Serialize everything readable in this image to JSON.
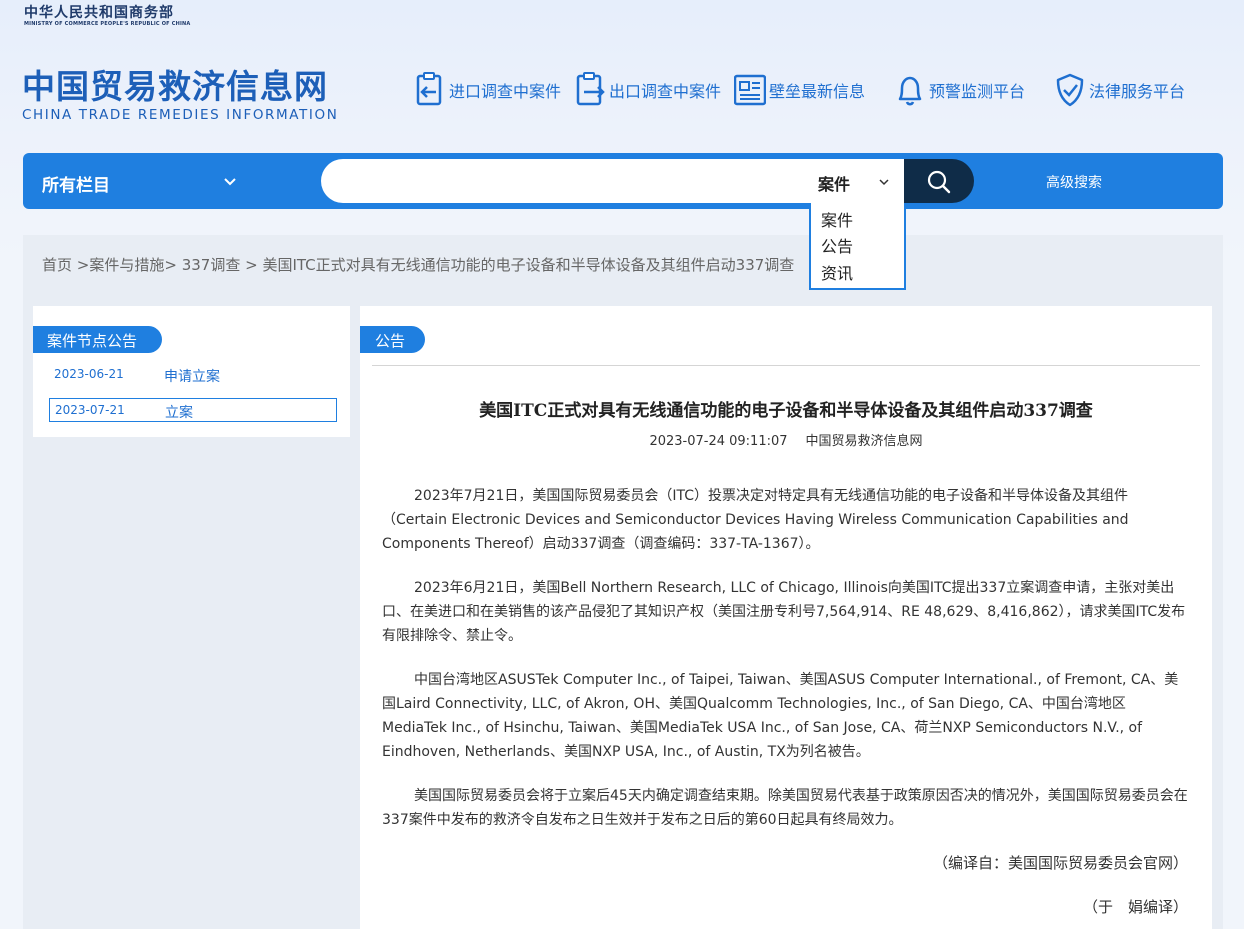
{
  "header": {
    "ministry_cn": "中华人民共和国商务部",
    "ministry_en": "MINISTRY OF COMMERCE PEOPLE'S REPUBLIC OF CHINA",
    "site_cn": "中国贸易救济信息网",
    "site_en": "CHINA TRADE REMEDIES INFORMATION",
    "nav": [
      {
        "label": "进口调查中案件",
        "icon": "import-document-icon"
      },
      {
        "label": "出口调查中案件",
        "icon": "export-document-icon"
      },
      {
        "label": "壁垒最新信息",
        "icon": "news-icon"
      },
      {
        "label": "预警监测平台",
        "icon": "bell-icon"
      },
      {
        "label": "法律服务平台",
        "icon": "shield-check-icon"
      }
    ]
  },
  "search": {
    "category": "所有栏目",
    "query": "",
    "type_selected": "案件",
    "type_options": [
      "案件",
      "公告",
      "资讯"
    ],
    "advanced_label": "高级搜索"
  },
  "breadcrumb": {
    "home": "首页",
    "sep1": " >",
    "level1": "案件与措施",
    "sep2": "> ",
    "level2": "337调查",
    "sep3": " > ",
    "current": "美国ITC正式对具有无线通信功能的电子设备和半导体设备及其组件启动337调查"
  },
  "sidebar": {
    "tab_label": "案件节点公告",
    "rows": [
      {
        "date": "2023-06-21",
        "label": "申请立案"
      },
      {
        "date": "2023-07-21",
        "label": "立案"
      }
    ]
  },
  "article": {
    "tab_label": "公告",
    "title": "美国ITC正式对具有无线通信功能的电子设备和半导体设备及其组件启动337调查",
    "datetime": "2023-07-24 09:11:07",
    "source": "中国贸易救济信息网",
    "paragraphs": [
      "2023年7月21日，美国国际贸易委员会（ITC）投票决定对特定具有无线通信功能的电子设备和半导体设备及其组件（Certain Electronic Devices and Semiconductor Devices Having Wireless Communication Capabilities and Components Thereof）启动337调查（调查编码：337-TA-1367）。",
      "2023年6月21日，美国Bell Northern Research, LLC of Chicago, Illinois向美国ITC提出337立案调查申请，主张对美出口、在美进口和在美销售的该产品侵犯了其知识产权（美国注册专利号7,564,914、RE 48,629、8,416,862），请求美国ITC发布有限排除令、禁止令。",
      "中国台湾地区ASUSTek Computer Inc., of Taipei, Taiwan、美国ASUS Computer International., of Fremont, CA、美国Laird Connectivity, LLC, of Akron, OH、美国Qualcomm Technologies, Inc., of San Diego, CA、中国台湾地区MediaTek Inc., of Hsinchu, Taiwan、美国MediaTek USA Inc., of San Jose, CA、荷兰NXP Semiconductors N.V., of Eindhoven, Netherlands、美国NXP USA, Inc., of Austin, TX为列名被告。",
      "美国国际贸易委员会将于立案后45天内确定调查结束期。除美国贸易代表基于政策原因否决的情况外，美国国际贸易委员会在337案件中发布的救济令自发布之日生效并于发布之日后的第60日起具有终局效力。"
    ],
    "source_note": "（编译自：美国国际贸易委员会官网）",
    "editor_note": "（于　娟编译）"
  }
}
